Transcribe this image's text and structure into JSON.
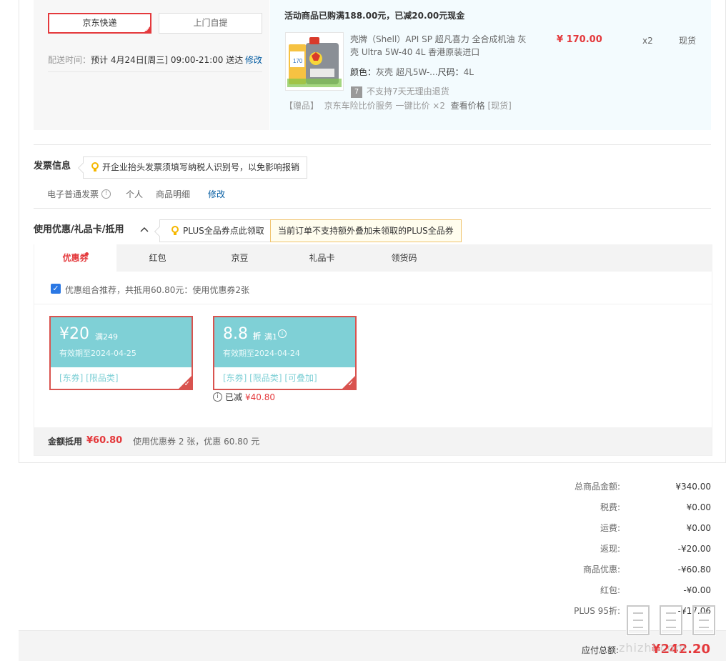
{
  "shipping": {
    "express_label": "京东快递",
    "pickup_label": "上门自提",
    "time_label": "配送时间：",
    "time_value": "预计 4月24日[周三] 09:00-21:00 送达",
    "edit_label": "修改"
  },
  "goods": {
    "promo": "活动商品已购满188.00元，已减20.00元现金",
    "name": "壳牌（Shell）API SP 超凡喜力 全合成机油 灰壳 Ultra 5W-40 4L 香港原装进口",
    "price": "¥ 170.00",
    "qty": "x2",
    "stock": "现货",
    "color_label": "颜色：",
    "color_value": "灰壳 超凡5W-...",
    "size_label": "尺码：",
    "size_value": "4L",
    "return_icon": "7",
    "return_text": "不支持7天无理由退货",
    "gift_tag": "【赠品】",
    "gift_name": "京东车险比价服务 一键比价 ×2",
    "gift_link": "查看价格",
    "gift_stock": "[现货]"
  },
  "invoice": {
    "title": "发票信息",
    "tip": "开企业抬头发票须填写纳税人识别号，以免影响报销",
    "type": "电子普通发票",
    "person": "个人",
    "detail": "商品明细",
    "edit": "修改"
  },
  "coupons": {
    "title": "使用优惠/礼品卡/抵用",
    "plus_tip": "PLUS全品券点此领取",
    "plus_warn": "当前订单不支持额外叠加未领取的PLUS全品券",
    "tabs": [
      {
        "label": "优惠券"
      },
      {
        "label": "红包"
      },
      {
        "label": "京豆"
      },
      {
        "label": "礼品卡"
      },
      {
        "label": "领货码"
      }
    ],
    "combo_text": "优惠组合推荐，共抵用60.80元：使用优惠券2张",
    "items": [
      {
        "amount": "¥20",
        "cond": "满249",
        "expiry": "有效期至2024-04-25",
        "tags": "[东券]  [限品类]"
      },
      {
        "amount": "8.8",
        "unit": "折",
        "cond": "满1",
        "expiry": "有效期至2024-04-24",
        "tags": "[东券]  [限品类]  [可叠加]"
      }
    ],
    "used_label": "已减",
    "used_amount": "¥40.80",
    "deduct_label": "金额抵用",
    "deduct_amount": "¥60.80",
    "deduct_desc": "使用优惠券 2 张，优惠 60.80 元"
  },
  "summary": [
    {
      "label": "总商品金额:",
      "value": "¥340.00"
    },
    {
      "label": "税费:",
      "value": "¥0.00"
    },
    {
      "label": "运费:",
      "value": "¥0.00"
    },
    {
      "label": "返现:",
      "value": "-¥20.00"
    },
    {
      "label": "商品优惠:",
      "value": "-¥60.80"
    },
    {
      "label": "红包:",
      "value": "-¥0.00"
    },
    {
      "label": "PLUS 95折:",
      "value": "-¥17.06"
    }
  ],
  "total": {
    "label": "应付总额:",
    "value": "¥242.20"
  },
  "watermark": {
    "text": "zhizhi.com"
  }
}
